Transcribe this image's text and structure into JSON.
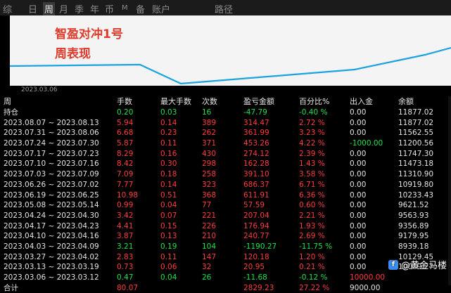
{
  "tabs": [
    "综",
    "日",
    "周",
    "月",
    "季",
    "年",
    "币",
    "M",
    "备",
    "账户",
    "路径"
  ],
  "active_tab": "周",
  "chart": {
    "title_line1": "智盈对冲1号",
    "title_line2": "周表现",
    "date_label": "2023.03.06",
    "line_color": "#1aa3e0"
  },
  "table": {
    "headers": [
      "周",
      "手数",
      "最大手数",
      "次数",
      "盈亏金额",
      "百分比%",
      "出入金",
      "余额"
    ],
    "rows": [
      {
        "period": "持仓",
        "lots": "0.20",
        "max_lots": "0.03",
        "count": "16",
        "pnl": "-47.79",
        "pct": "-0.40 %",
        "flow": "0.00",
        "balance": "11877.02",
        "tone": "g"
      },
      {
        "period": "2023.08.07 ~ 2023.08.13",
        "lots": "5.94",
        "max_lots": "0.14",
        "count": "389",
        "pnl": "314.47",
        "pct": "2.72 %",
        "flow": "0.00",
        "balance": "11877.02",
        "tone": "r"
      },
      {
        "period": "2023.07.31 ~ 2023.08.06",
        "lots": "6.68",
        "max_lots": "0.23",
        "count": "262",
        "pnl": "361.99",
        "pct": "3.23 %",
        "flow": "0.00",
        "balance": "11562.55",
        "tone": "r"
      },
      {
        "period": "2023.07.24 ~ 2023.07.30",
        "lots": "5.87",
        "max_lots": "0.11",
        "count": "371",
        "pnl": "453.26",
        "pct": "4.22 %",
        "flow": "-1000.00",
        "balance": "11200.56",
        "tone": "r",
        "flow_tone": "g"
      },
      {
        "period": "2023.07.17 ~ 2023.07.23",
        "lots": "8.29",
        "max_lots": "0.16",
        "count": "430",
        "pnl": "274.12",
        "pct": "2.39 %",
        "flow": "0.00",
        "balance": "11747.30",
        "tone": "r"
      },
      {
        "period": "2023.07.10 ~ 2023.07.16",
        "lots": "8.42",
        "max_lots": "0.30",
        "count": "298",
        "pnl": "162.28",
        "pct": "1.43 %",
        "flow": "0.00",
        "balance": "11473.18",
        "tone": "r"
      },
      {
        "period": "2023.07.03 ~ 2023.07.09",
        "lots": "7.09",
        "max_lots": "0.18",
        "count": "258",
        "pnl": "391.10",
        "pct": "3.58 %",
        "flow": "0.00",
        "balance": "11310.90",
        "tone": "r"
      },
      {
        "period": "2023.06.26 ~ 2023.07.02",
        "lots": "7.77",
        "max_lots": "0.14",
        "count": "323",
        "pnl": "686.37",
        "pct": "6.71 %",
        "flow": "0.00",
        "balance": "10919.80",
        "tone": "r"
      },
      {
        "period": "2023.06.19 ~ 2023.06.25",
        "lots": "10.98",
        "max_lots": "0.51",
        "count": "368",
        "pnl": "611.91",
        "pct": "6.36 %",
        "flow": "0.00",
        "balance": "10233.43",
        "tone": "r"
      },
      {
        "period": "2023.05.08 ~ 2023.05.14",
        "lots": "0.99",
        "max_lots": "0.04",
        "count": "77",
        "pnl": "57.59",
        "pct": "0.60 %",
        "flow": "0.00",
        "balance": "9621.52",
        "tone": "r"
      },
      {
        "period": "2023.04.24 ~ 2023.04.30",
        "lots": "3.42",
        "max_lots": "0.07",
        "count": "221",
        "pnl": "207.04",
        "pct": "2.21 %",
        "flow": "0.00",
        "balance": "9563.93",
        "tone": "r"
      },
      {
        "period": "2023.04.17 ~ 2023.04.23",
        "lots": "4.41",
        "max_lots": "0.15",
        "count": "226",
        "pnl": "176.94",
        "pct": "1.93 %",
        "flow": "0.00",
        "balance": "9356.89",
        "tone": "r"
      },
      {
        "period": "2023.04.10 ~ 2023.04.16",
        "lots": "3.87",
        "max_lots": "0.13",
        "count": "210",
        "pnl": "240.77",
        "pct": "2.69 %",
        "flow": "0.00",
        "balance": "9179.95",
        "tone": "r"
      },
      {
        "period": "2023.04.03 ~ 2023.04.09",
        "lots": "3.21",
        "max_lots": "0.19",
        "count": "104",
        "pnl": "-1190.27",
        "pct": "-11.75 %",
        "flow": "0.00",
        "balance": "8939.18",
        "tone": "g"
      },
      {
        "period": "2023.03.27 ~ 2023.04.02",
        "lots": "2.83",
        "max_lots": "0.11",
        "count": "147",
        "pnl": "120.18",
        "pct": "1.20 %",
        "flow": "0.00",
        "balance": "10129.45",
        "tone": "r"
      },
      {
        "period": "2023.03.13 ~ 2023.03.19",
        "lots": "0.73",
        "max_lots": "0.06",
        "count": "32",
        "pnl": "20.95",
        "pct": "0.21 %",
        "flow": "0.00",
        "balance": "10009.27",
        "tone": "r"
      },
      {
        "period": "2023.03.06 ~ 2023.03.12",
        "lots": "0.47",
        "max_lots": "0.04",
        "count": "26",
        "pnl": "-11.68",
        "pct": "-0.12 %",
        "flow": "10000.00",
        "balance": "",
        "tone": "g",
        "flow_tone": "r"
      },
      {
        "period": "合计",
        "lots": "80.07",
        "max_lots": "",
        "count": "",
        "pnl": "2829.23",
        "pct": "27.22 %",
        "flow": "9000.00",
        "balance": "",
        "tone": "r"
      }
    ]
  },
  "watermark": {
    "icon": "f",
    "text": "@黄金马楼"
  }
}
